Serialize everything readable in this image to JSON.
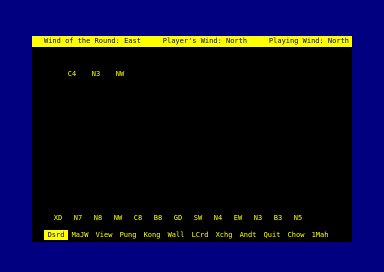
{
  "status": {
    "round_wind": "Wind of the Round: East",
    "player_wind": "Player's Wind: North",
    "playing_wind": "Playing Wind: North"
  },
  "exposed_tiles": [
    "C4",
    "N3",
    "NW"
  ],
  "hand_tiles": [
    "XD",
    "N7",
    "N8",
    "NW",
    "C8",
    "B8",
    "GD",
    "SW",
    "N4",
    "EW",
    "N3",
    "B3",
    "N5"
  ],
  "menu": [
    "Dsrd",
    "MaJW",
    "View",
    "Pung",
    "Kong",
    "Wall",
    "LCrd",
    "Xchg",
    "Andt",
    "Quit",
    "Chow",
    "1Mah"
  ],
  "selected_menu": "Dsrd",
  "colors": {
    "border": "#000080",
    "background": "#000000",
    "text": "#ffff00",
    "highlight": "#ffff00"
  }
}
